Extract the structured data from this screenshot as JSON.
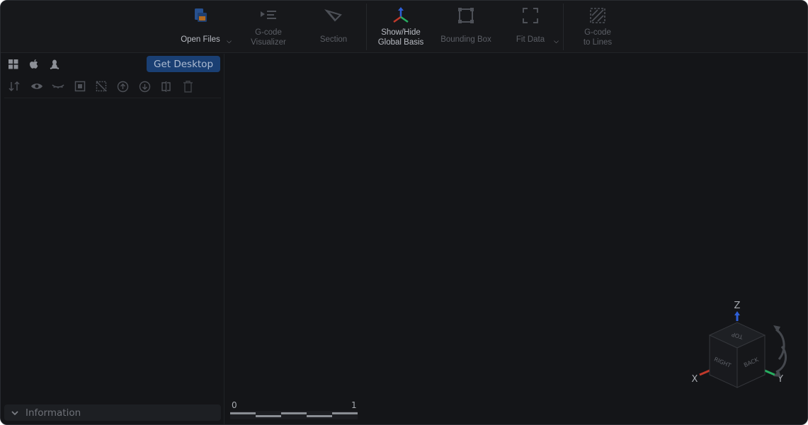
{
  "toolbar": {
    "open_files": "Open Files",
    "gcode_visualizer": "G-code\nVisualizer",
    "section": "Section",
    "show_hide_basis": "Show/Hide\nGlobal Basis",
    "bounding_box": "Bounding Box",
    "fit_data": "Fit Data",
    "gcode_to_lines": "G-code\nto Lines"
  },
  "left_panel": {
    "os_icons": [
      "windows-icon",
      "apple-icon",
      "linux-icon"
    ],
    "get_desktop": "Get Desktop",
    "tools": [
      "sort-icon",
      "show-icon",
      "hide-icon",
      "isolate-icon",
      "hide-all-icon",
      "move-up-icon",
      "move-down-icon",
      "split-icon",
      "delete-icon"
    ],
    "information": "Information"
  },
  "viewport": {
    "scale_start": "0",
    "scale_end": "1",
    "gizmo": {
      "axis_z": "Z",
      "axis_x": "X",
      "axis_y": "Y",
      "face_top": "TOP",
      "face_right": "RIGHT",
      "face_back": "BACK"
    }
  },
  "colors": {
    "accent": "#1a3f73",
    "background": "#141518",
    "axis_x": "#c0392b",
    "axis_y": "#27ae60",
    "axis_z": "#2e5fd6"
  }
}
